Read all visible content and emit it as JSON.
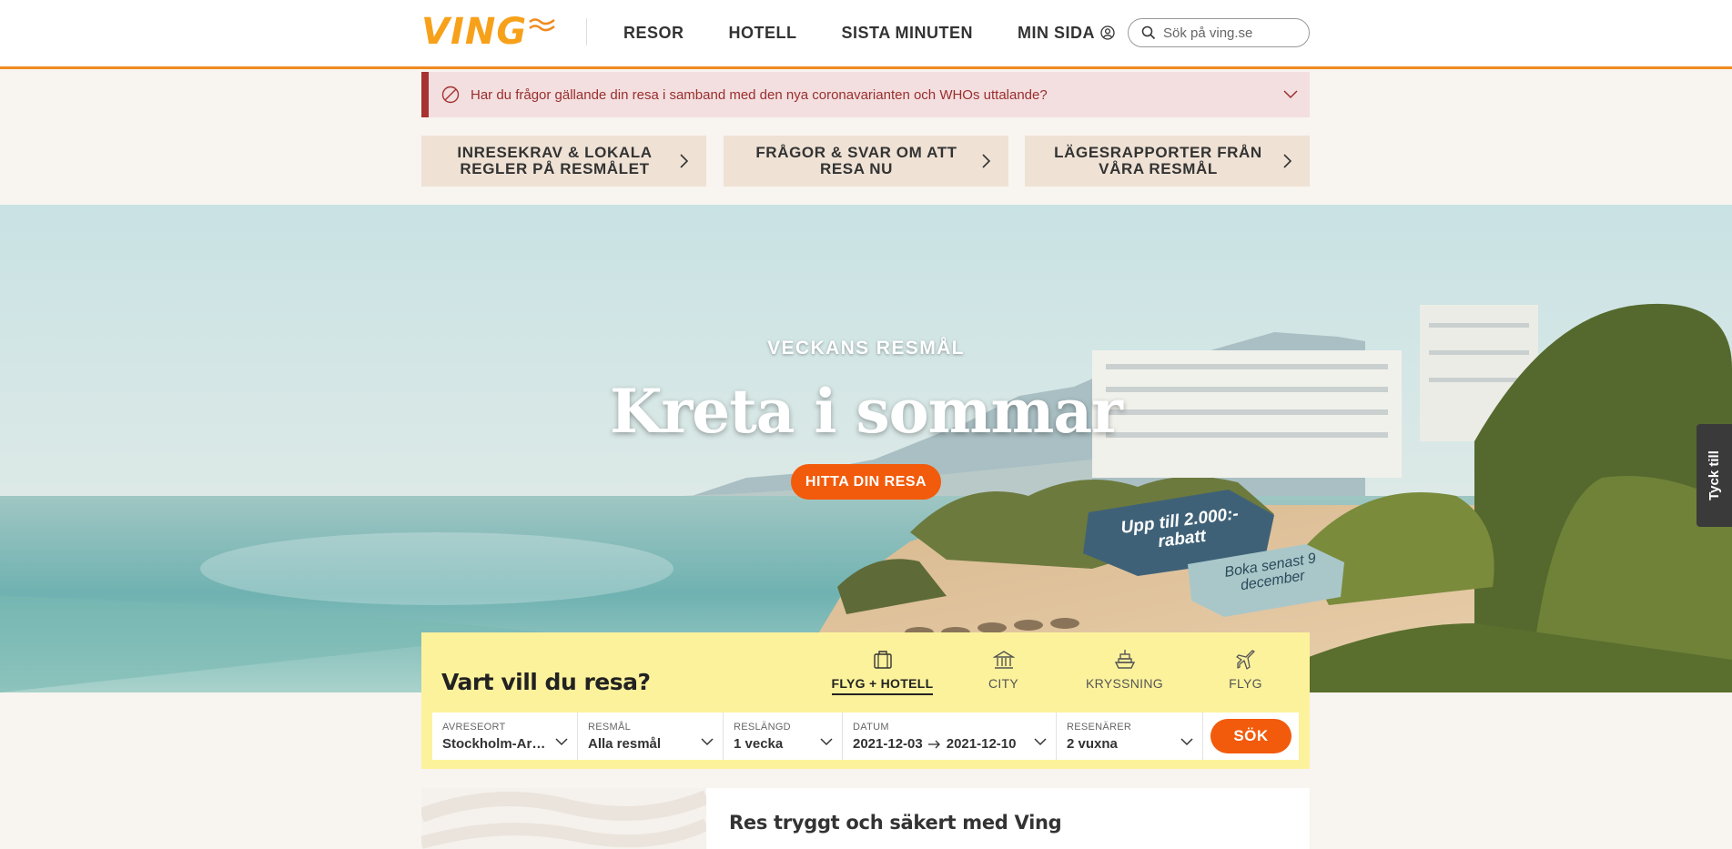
{
  "header": {
    "logo_text": "VING",
    "nav": [
      {
        "label": "RESOR"
      },
      {
        "label": "HOTELL"
      },
      {
        "label": "SISTA MINUTEN"
      },
      {
        "label": "MIN SIDA"
      }
    ],
    "search_placeholder": "Sök på ving.se"
  },
  "alert": {
    "text": "Har du frågor gällande din resa i samband med den nya coronavarianten och WHOs uttalande?"
  },
  "info_buttons": [
    {
      "label_line1": "INRESEKRAV & LOKALA",
      "label_line2": "REGLER PÅ RESMÅLET"
    },
    {
      "label_line1": "FRÅGOR & SVAR OM ATT",
      "label_line2": "RESA NU"
    },
    {
      "label_line1": "LÄGESRAPPORTER FRÅN",
      "label_line2": "VÅRA RESMÅL"
    }
  ],
  "hero": {
    "kicker": "VECKANS RESMÅL",
    "title": "Kreta i sommar",
    "cta": "HITTA DIN RESA",
    "promo_main_line1": "Upp till 2.000:-",
    "promo_main_line2": "rabatt",
    "promo_sub_line1": "Boka senast 9",
    "promo_sub_line2": "december"
  },
  "feedback_tab": "Tyck till",
  "search_panel": {
    "title": "Vart vill du resa?",
    "tabs": [
      {
        "label": "FLYG + HOTELL",
        "icon": "suitcase-icon",
        "active": true
      },
      {
        "label": "CITY",
        "icon": "building-icon",
        "active": false
      },
      {
        "label": "KRYSSNING",
        "icon": "ship-icon",
        "active": false
      },
      {
        "label": "FLYG",
        "icon": "plane-icon",
        "active": false
      }
    ],
    "fields": {
      "departure": {
        "label": "AVRESEORT",
        "value": "Stockholm-Arlanda"
      },
      "destination": {
        "label": "RESMÅL",
        "value": "Alla resmål"
      },
      "duration": {
        "label": "RESLÄNGD",
        "value": "1 vecka"
      },
      "date": {
        "label": "DATUM",
        "from": "2021-12-03",
        "to": "2021-12-10"
      },
      "travelers": {
        "label": "RESENÄRER",
        "value": "2 vuxna"
      }
    },
    "submit": "SÖK"
  },
  "card": {
    "title": "Res tryggt och säkert med Ving"
  },
  "colors": {
    "brand_orange": "#f25b0b",
    "logo_orange": "#f7a11a",
    "panel_yellow": "#fdf29c",
    "alert_red": "#a63232",
    "info_beige": "#efe2d5"
  }
}
